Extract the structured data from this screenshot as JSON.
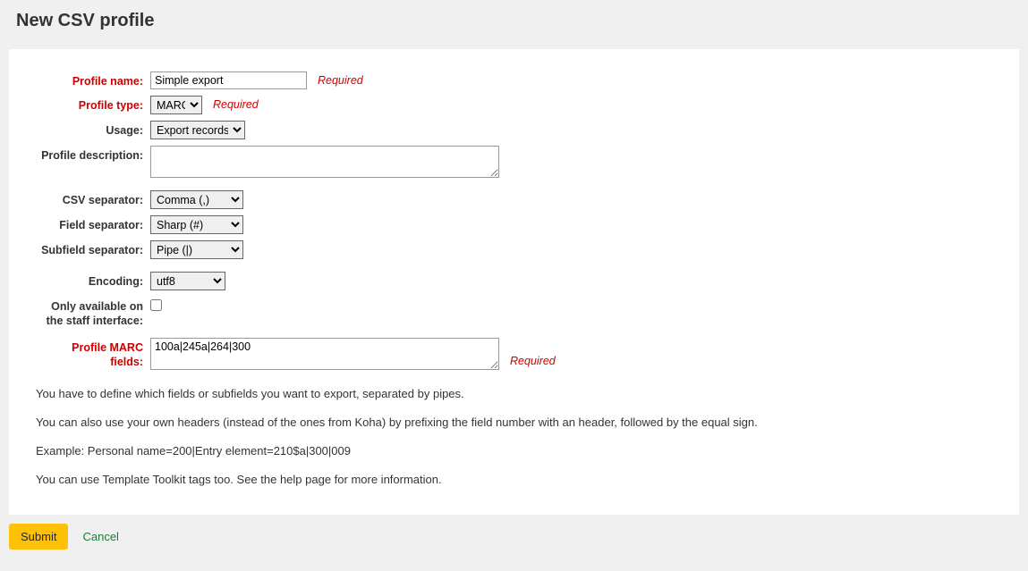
{
  "page": {
    "title": "New CSV profile"
  },
  "labels": {
    "profile_name": "Profile name:",
    "profile_type": "Profile type:",
    "usage": "Usage:",
    "profile_description": "Profile description:",
    "csv_separator": "CSV separator:",
    "field_separator": "Field separator:",
    "subfield_separator": "Subfield separator:",
    "encoding": "Encoding:",
    "only_staff": "Only available on the staff interface:",
    "profile_marc": "Profile MARC fields:"
  },
  "values": {
    "profile_name": "Simple export",
    "profile_type": "MARC",
    "usage": "Export records",
    "profile_description": "",
    "csv_separator": "Comma (,)",
    "field_separator": "Sharp (#)",
    "subfield_separator": "Pipe (|)",
    "encoding": "utf8",
    "only_staff": false,
    "profile_marc": "100a|245a|264|300"
  },
  "hints": {
    "required": "Required"
  },
  "help": {
    "line1": "You have to define which fields or subfields you want to export, separated by pipes.",
    "line2": "You can also use your own headers (instead of the ones from Koha) by prefixing the field number with an header, followed by the equal sign.",
    "line3": "Example: Personal name=200|Entry element=210$a|300|009",
    "line4": "You can use Template Toolkit tags too. See the help page for more information."
  },
  "actions": {
    "submit": "Submit",
    "cancel": "Cancel"
  }
}
